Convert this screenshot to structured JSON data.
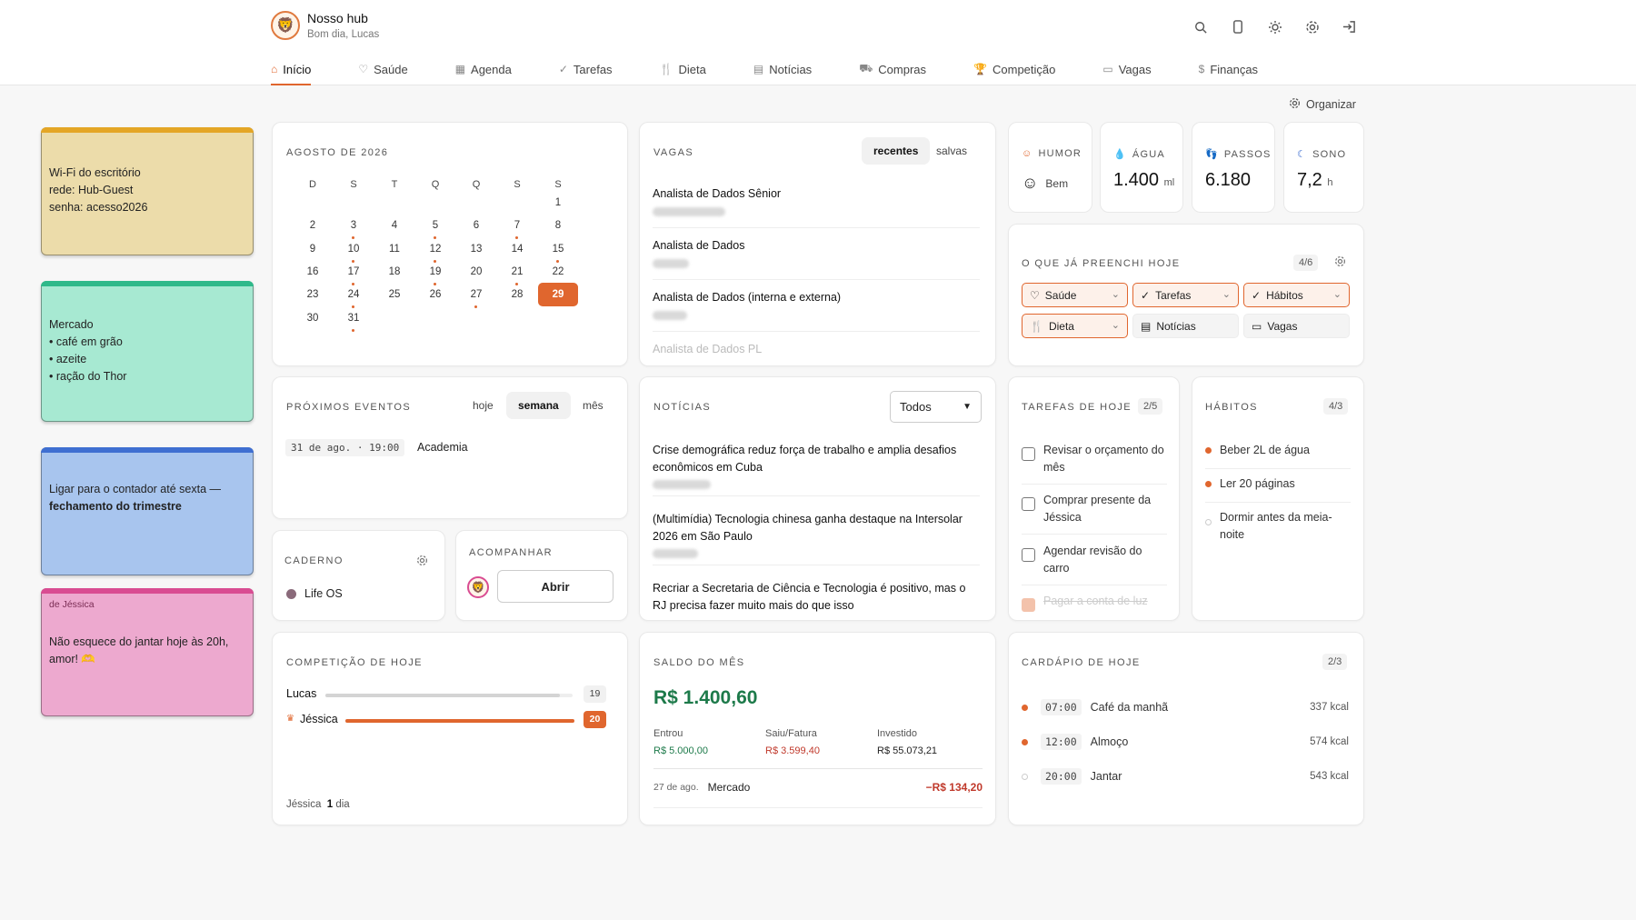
{
  "header": {
    "title": "Nosso hub",
    "greeting": "Bom dia, Lucas"
  },
  "tabs": [
    {
      "label": "Início",
      "icon": "home-icon"
    },
    {
      "label": "Saúde",
      "icon": "heart-icon"
    },
    {
      "label": "Agenda",
      "icon": "calendar-icon"
    },
    {
      "label": "Tarefas",
      "icon": "check-icon"
    },
    {
      "label": "Dieta",
      "icon": "fork-knife-icon"
    },
    {
      "label": "Notícias",
      "icon": "newspaper-icon"
    },
    {
      "label": "Compras",
      "icon": "cart-icon"
    },
    {
      "label": "Competição",
      "icon": "trophy-icon"
    },
    {
      "label": "Vagas",
      "icon": "briefcase-icon"
    },
    {
      "label": "Finanças",
      "icon": "dollar-icon"
    }
  ],
  "organize_label": "Organizar",
  "notes": [
    {
      "color": "#ecdcaa",
      "stripe": "#e4a626",
      "title": "Wi-Fi do escritório",
      "lines": [
        "rede: Hub-Guest",
        "senha: acesso2026"
      ]
    },
    {
      "color": "#a7e9d2",
      "stripe": "#2fb98a",
      "title": "Mercado",
      "lines": [
        "• café em grão",
        "• azeite",
        "• ração do Thor"
      ]
    },
    {
      "color": "#a8c5ee",
      "stripe": "#3f6fd1",
      "text": "Ligar para o contador até sexta —",
      "bold": "fechamento do trimestre"
    },
    {
      "color": "#eda9cf",
      "stripe": "#d94c92",
      "from": "de Jéssica",
      "text": "Não esquece do jantar hoje às 20h, amor! 🫶"
    }
  ],
  "calendar": {
    "title": "AGOSTO DE 2026",
    "weekdays": [
      "D",
      "S",
      "T",
      "Q",
      "Q",
      "S",
      "S"
    ],
    "today": 29
  },
  "jobs": {
    "title": "VAGAS",
    "tab_recent": "recentes",
    "tab_saved": "salvas",
    "items": [
      "Analista de Dados Sênior",
      "Analista de Dados",
      "Analista de Dados (interna e externa)",
      "Analista de Dados PL"
    ]
  },
  "metrics": {
    "humor": {
      "label": "HUMOR",
      "value": "Bem"
    },
    "agua": {
      "label": "ÁGUA",
      "value": "1.400",
      "unit": "ml"
    },
    "passos": {
      "label": "PASSOS",
      "value": "6.180"
    },
    "sono": {
      "label": "SONO",
      "value": "7,2",
      "unit": "h"
    }
  },
  "filled": {
    "title": "O QUE JÁ PREENCHI HOJE",
    "count": "4/6",
    "chips": [
      "Saúde",
      "Tarefas",
      "Hábitos",
      "Dieta",
      "Notícias",
      "Vagas"
    ]
  },
  "events": {
    "title": "PRÓXIMOS EVENTOS",
    "tabs": [
      "hoje",
      "semana",
      "mês"
    ],
    "date": "31 de ago. · 19:00",
    "name": "Academia"
  },
  "news": {
    "title": "NOTÍCIAS",
    "filter": "Todos",
    "items": [
      "Crise demográfica reduz força de trabalho e amplia desafios econômicos em Cuba",
      "(Multimídia) Tecnologia chinesa ganha destaque na Intersolar 2026 em São Paulo",
      "Recriar a Secretaria de Ciência e Tecnologia é positivo, mas o RJ precisa fazer muito mais do que isso"
    ]
  },
  "tasks": {
    "title": "TAREFAS DE HOJE",
    "count": "2/5",
    "items": [
      "Revisar o orçamento do mês",
      "Comprar presente da Jéssica",
      "Agendar revisão do carro",
      "Pagar a conta de luz"
    ]
  },
  "habits": {
    "title": "HÁBITOS",
    "count": "4/3",
    "items": [
      "Beber 2L de água",
      "Ler 20 páginas",
      "Dormir antes da meia-noite"
    ]
  },
  "notebook": {
    "title": "CADERNO",
    "item": "Life OS"
  },
  "follow": {
    "title": "ACOMPANHAR",
    "button": "Abrir"
  },
  "competition": {
    "title": "COMPETIÇÃO DE HOJE",
    "players": [
      {
        "name": "Lucas",
        "score": 19
      },
      {
        "name": "Jéssica",
        "score": 20
      }
    ],
    "streak_name": "Jéssica",
    "streak_value": "1",
    "streak_unit": "dia"
  },
  "finance": {
    "title": "SALDO DO MÊS",
    "balance": "R$ 1.400,60",
    "in_label": "Entrou",
    "in_value": "R$ 5.000,00",
    "out_label": "Saiu/Fatura",
    "out_value": "R$ 3.599,40",
    "inv_label": "Investido",
    "inv_value": "R$ 55.073,21",
    "last_date": "27 de ago.",
    "last_name": "Mercado",
    "last_value": "−R$ 134,20"
  },
  "menu": {
    "title": "CARDÁPIO DE HOJE",
    "count": "2/3",
    "items": [
      {
        "time": "07:00",
        "name": "Café da manhã",
        "kcal": "337 kcal"
      },
      {
        "time": "12:00",
        "name": "Almoço",
        "kcal": "574 kcal"
      },
      {
        "time": "20:00",
        "name": "Jantar",
        "kcal": "543 kcal"
      }
    ]
  }
}
